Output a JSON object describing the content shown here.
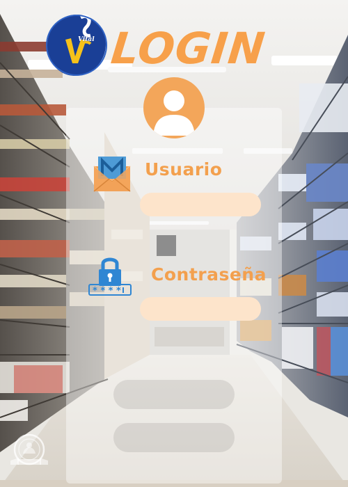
{
  "header": {
    "title": "LOGIN",
    "brand_logo_text": "Vital"
  },
  "form": {
    "user_label": "Usuario",
    "user_value": "",
    "password_label": "Contraseña",
    "password_value": "",
    "primary_button_label": "",
    "secondary_button_label": ""
  },
  "icons": {
    "avatar": "user-avatar-icon",
    "user": "envelope-icon",
    "password": "padlock-password-icon",
    "seal": "seal-watermark-icon"
  },
  "colors": {
    "accent_orange": "#f3a04e",
    "field_fill": "#fde4cb",
    "logo_blue": "#1a3f96",
    "logo_yellow": "#f6c21a"
  }
}
